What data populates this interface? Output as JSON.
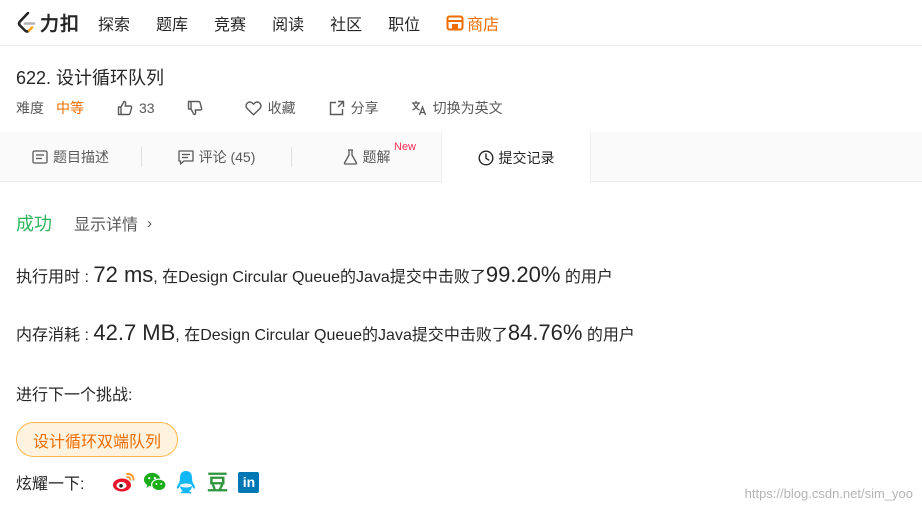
{
  "nav": {
    "logo_text": "力扣",
    "items": [
      "探索",
      "题库",
      "竞赛",
      "阅读",
      "社区",
      "职位"
    ],
    "store_label": "商店",
    "accent": "#ef6c00"
  },
  "question": {
    "title": "622. 设计循环队列",
    "difficulty_label": "难度",
    "difficulty": "中等",
    "likes": "33",
    "favorite_label": "收藏",
    "share_label": "分享",
    "translate_label": "切换为英文"
  },
  "tabs": {
    "description": "题目描述",
    "comments": "评论 (45)",
    "solutions": "题解",
    "solutions_badge": "New",
    "submissions": "提交记录"
  },
  "result": {
    "status": "成功",
    "status_color": "#2db55d",
    "details_label": "显示详情",
    "details_chevron": "›",
    "runtime_label": "执行用时 :",
    "runtime_value": "72 ms",
    "runtime_prefix": ", 在Design Circular Queue的Java提交中击败了",
    "runtime_pct": "99.20%",
    "runtime_suffix": " 的用户",
    "memory_label": "内存消耗 :",
    "memory_value": "42.7 MB",
    "memory_prefix": ", 在Design Circular Queue的Java提交中击败了",
    "memory_pct": "84.76%",
    "memory_suffix": " 的用户"
  },
  "next": {
    "label": "进行下一个挑战:",
    "button": "设计循环双端队列"
  },
  "share": {
    "label": "炫耀一下:",
    "icons": [
      "weibo-icon",
      "wechat-icon",
      "qq-icon",
      "douban-icon",
      "linkedin-icon"
    ],
    "douban_glyph": "豆",
    "linkedin_glyph": "in"
  },
  "watermark": "https://blog.csdn.net/sim_yoo"
}
